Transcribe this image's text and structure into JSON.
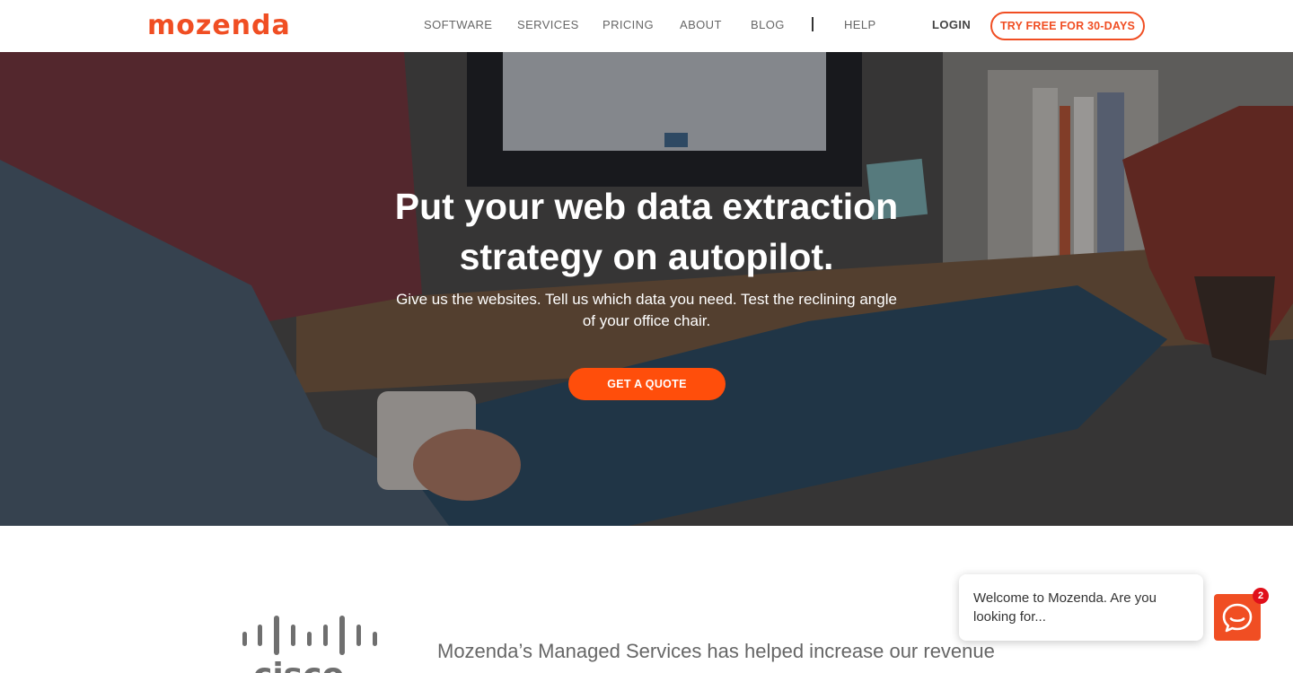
{
  "header": {
    "logo_text": "mozenda",
    "nav": [
      "SOFTWARE",
      "SERVICES",
      "PRICING",
      "ABOUT",
      "BLOG",
      "HELP"
    ],
    "login_label": "LOGIN",
    "cta_label": "TRY FREE FOR 30-DAYS"
  },
  "hero": {
    "title_line1": "Put your web data extraction",
    "title_line2": "strategy on autopilot.",
    "subtitle": "Give us the websites. Tell us which data you need. Test the reclining angle of your office chair.",
    "button_label": "GET A QUOTE"
  },
  "testimonial": {
    "company": "cisco",
    "quote": "Mozenda’s Managed Services has helped increase our revenue"
  },
  "chat": {
    "message": "Welcome to Mozenda. Are you looking for...",
    "badge_count": "2"
  },
  "colors": {
    "brand": "#f04e23",
    "cta": "#ff4e0b",
    "badge": "#e0101b"
  },
  "icons": [
    "chat-icon",
    "cisco-logo"
  ]
}
